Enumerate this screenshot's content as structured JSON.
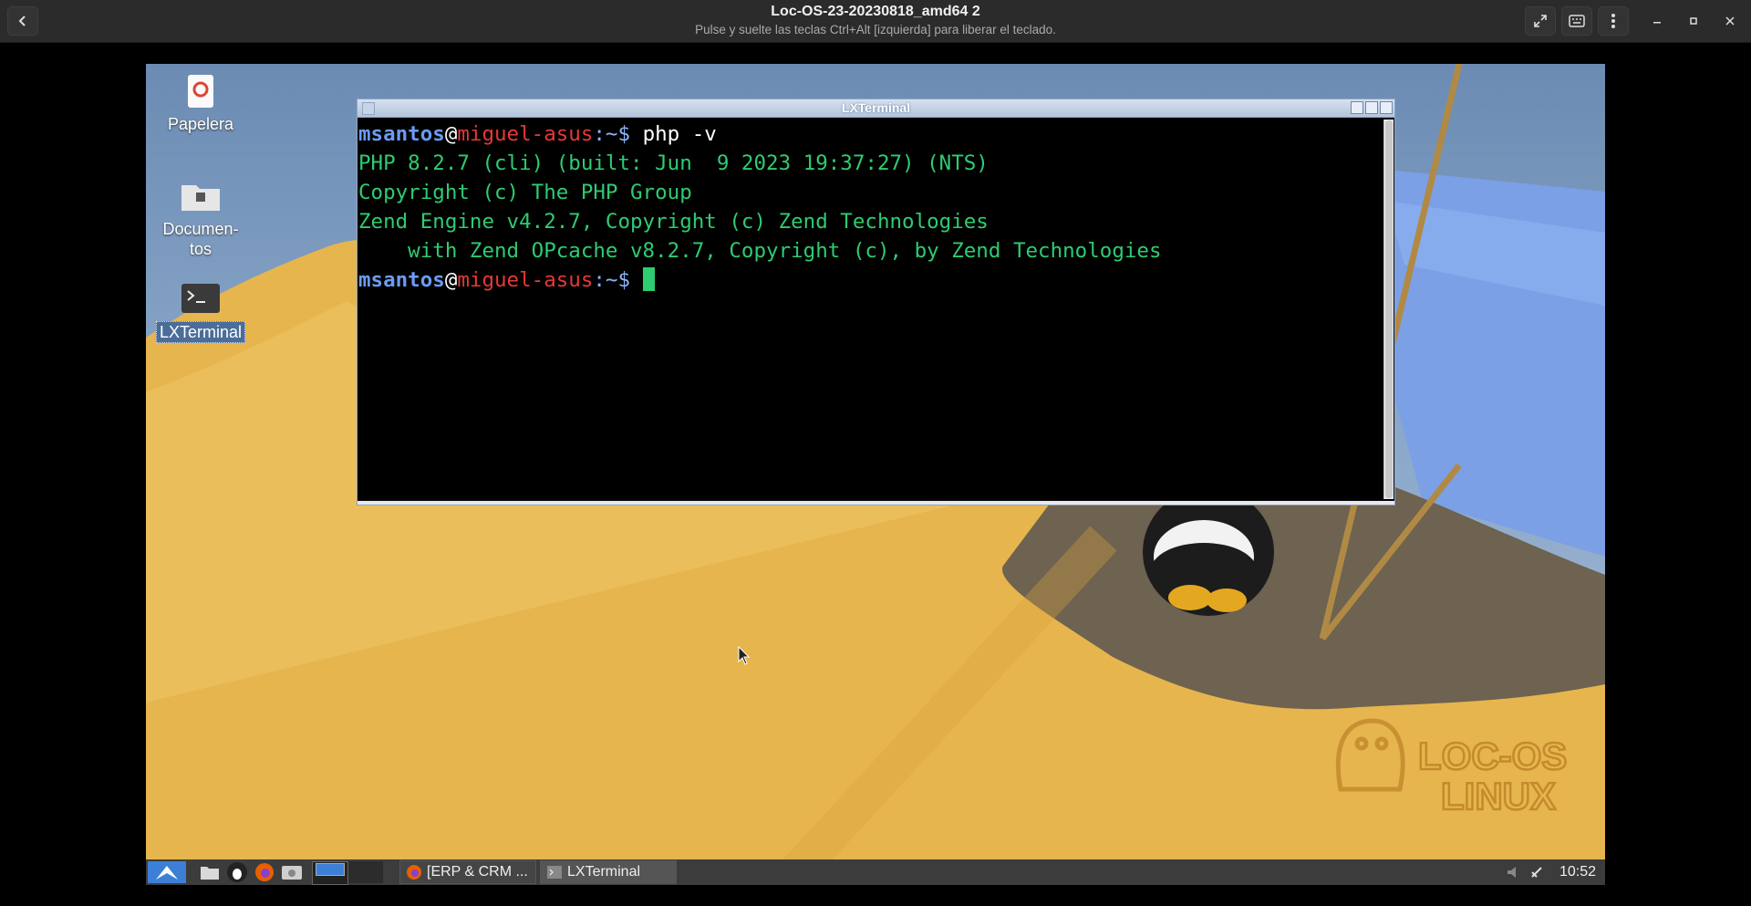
{
  "header": {
    "title": "Loc-OS-23-20230818_amd64 2",
    "subtitle": "Pulse y suelte las teclas Ctrl+Alt [izquierda] para liberar el teclado.",
    "icons": [
      "back-icon",
      "fullscreen-icon",
      "keyboard-icon",
      "menu-icon",
      "minimize-icon",
      "maximize-icon",
      "close-icon"
    ]
  },
  "desktop": {
    "icons": [
      {
        "label": "Papelera",
        "icon": "trash-icon"
      },
      {
        "label": "Documen-\ntos",
        "icon": "folder-icon"
      },
      {
        "label": "LXTerminal",
        "icon": "terminal-icon"
      }
    ],
    "logo_text": "LOC-OS LINUX"
  },
  "terminal": {
    "title": "LXTerminal",
    "prompt_user": "msantos",
    "prompt_at": "@",
    "prompt_host": "miguel-asus",
    "prompt_path": ":~$",
    "command": " php -v",
    "output": [
      "PHP 8.2.7 (cli) (built: Jun  9 2023 19:37:27) (NTS)",
      "Copyright (c) The PHP Group",
      "Zend Engine v4.2.7, Copyright (c) Zend Technologies",
      "    with Zend OPcache v8.2.7, Copyright (c), by Zend Technologies"
    ]
  },
  "taskbar": {
    "tasks": [
      {
        "label": "[ERP & CRM ...",
        "icon": "firefox-icon"
      },
      {
        "label": "LXTerminal",
        "icon": "terminal-icon"
      }
    ],
    "clock": "10:52"
  },
  "colors": {
    "prompt_user": "#6b9cf5",
    "prompt_host": "#e53935",
    "terminal_text": "#2ecc71",
    "taskbar_bg": "#3c3c3c"
  }
}
